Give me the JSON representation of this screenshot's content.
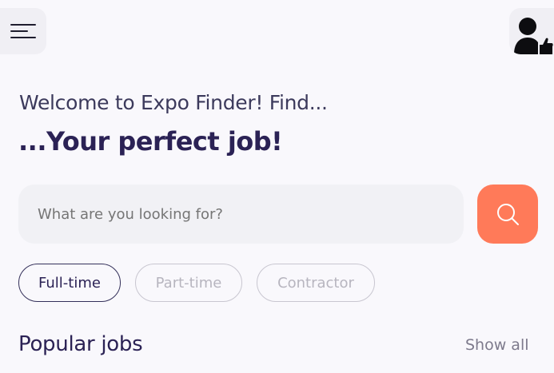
{
  "header": {
    "menu_icon": "hamburger-menu-icon",
    "avatar_icon": "user-thumbs-up-icon"
  },
  "hero": {
    "welcome_text": "Welcome to Expo Finder! Find...",
    "headline": "...Your perfect job!"
  },
  "search": {
    "placeholder": "What are you looking for?",
    "button_icon": "search-icon"
  },
  "filters": {
    "chips": [
      {
        "label": "Full-time",
        "active": true
      },
      {
        "label": "Part-time",
        "active": false
      },
      {
        "label": "Contractor",
        "active": false
      }
    ]
  },
  "popular": {
    "title": "Popular jobs",
    "show_all_label": "Show all"
  },
  "colors": {
    "accent": "#ff7a59",
    "primary_text": "#2b2255",
    "background": "#f9f8fc"
  }
}
